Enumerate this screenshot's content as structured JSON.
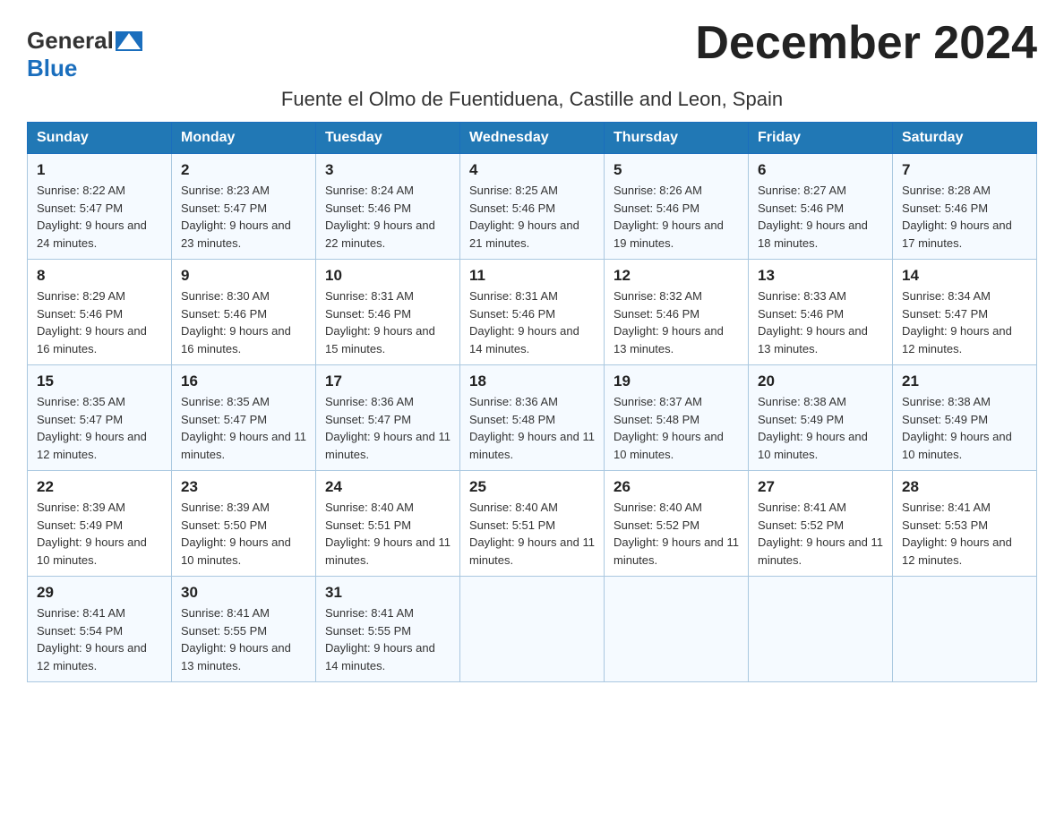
{
  "header": {
    "logo_general": "General",
    "logo_blue": "Blue",
    "month_title": "December 2024",
    "location": "Fuente el Olmo de Fuentiduena, Castille and Leon, Spain"
  },
  "days_of_week": [
    "Sunday",
    "Monday",
    "Tuesday",
    "Wednesday",
    "Thursday",
    "Friday",
    "Saturday"
  ],
  "weeks": [
    [
      {
        "day": "1",
        "sunrise": "8:22 AM",
        "sunset": "5:47 PM",
        "daylight": "9 hours and 24 minutes."
      },
      {
        "day": "2",
        "sunrise": "8:23 AM",
        "sunset": "5:47 PM",
        "daylight": "9 hours and 23 minutes."
      },
      {
        "day": "3",
        "sunrise": "8:24 AM",
        "sunset": "5:46 PM",
        "daylight": "9 hours and 22 minutes."
      },
      {
        "day": "4",
        "sunrise": "8:25 AM",
        "sunset": "5:46 PM",
        "daylight": "9 hours and 21 minutes."
      },
      {
        "day": "5",
        "sunrise": "8:26 AM",
        "sunset": "5:46 PM",
        "daylight": "9 hours and 19 minutes."
      },
      {
        "day": "6",
        "sunrise": "8:27 AM",
        "sunset": "5:46 PM",
        "daylight": "9 hours and 18 minutes."
      },
      {
        "day": "7",
        "sunrise": "8:28 AM",
        "sunset": "5:46 PM",
        "daylight": "9 hours and 17 minutes."
      }
    ],
    [
      {
        "day": "8",
        "sunrise": "8:29 AM",
        "sunset": "5:46 PM",
        "daylight": "9 hours and 16 minutes."
      },
      {
        "day": "9",
        "sunrise": "8:30 AM",
        "sunset": "5:46 PM",
        "daylight": "9 hours and 16 minutes."
      },
      {
        "day": "10",
        "sunrise": "8:31 AM",
        "sunset": "5:46 PM",
        "daylight": "9 hours and 15 minutes."
      },
      {
        "day": "11",
        "sunrise": "8:31 AM",
        "sunset": "5:46 PM",
        "daylight": "9 hours and 14 minutes."
      },
      {
        "day": "12",
        "sunrise": "8:32 AM",
        "sunset": "5:46 PM",
        "daylight": "9 hours and 13 minutes."
      },
      {
        "day": "13",
        "sunrise": "8:33 AM",
        "sunset": "5:46 PM",
        "daylight": "9 hours and 13 minutes."
      },
      {
        "day": "14",
        "sunrise": "8:34 AM",
        "sunset": "5:47 PM",
        "daylight": "9 hours and 12 minutes."
      }
    ],
    [
      {
        "day": "15",
        "sunrise": "8:35 AM",
        "sunset": "5:47 PM",
        "daylight": "9 hours and 12 minutes."
      },
      {
        "day": "16",
        "sunrise": "8:35 AM",
        "sunset": "5:47 PM",
        "daylight": "9 hours and 11 minutes."
      },
      {
        "day": "17",
        "sunrise": "8:36 AM",
        "sunset": "5:47 PM",
        "daylight": "9 hours and 11 minutes."
      },
      {
        "day": "18",
        "sunrise": "8:36 AM",
        "sunset": "5:48 PM",
        "daylight": "9 hours and 11 minutes."
      },
      {
        "day": "19",
        "sunrise": "8:37 AM",
        "sunset": "5:48 PM",
        "daylight": "9 hours and 10 minutes."
      },
      {
        "day": "20",
        "sunrise": "8:38 AM",
        "sunset": "5:49 PM",
        "daylight": "9 hours and 10 minutes."
      },
      {
        "day": "21",
        "sunrise": "8:38 AM",
        "sunset": "5:49 PM",
        "daylight": "9 hours and 10 minutes."
      }
    ],
    [
      {
        "day": "22",
        "sunrise": "8:39 AM",
        "sunset": "5:49 PM",
        "daylight": "9 hours and 10 minutes."
      },
      {
        "day": "23",
        "sunrise": "8:39 AM",
        "sunset": "5:50 PM",
        "daylight": "9 hours and 10 minutes."
      },
      {
        "day": "24",
        "sunrise": "8:40 AM",
        "sunset": "5:51 PM",
        "daylight": "9 hours and 11 minutes."
      },
      {
        "day": "25",
        "sunrise": "8:40 AM",
        "sunset": "5:51 PM",
        "daylight": "9 hours and 11 minutes."
      },
      {
        "day": "26",
        "sunrise": "8:40 AM",
        "sunset": "5:52 PM",
        "daylight": "9 hours and 11 minutes."
      },
      {
        "day": "27",
        "sunrise": "8:41 AM",
        "sunset": "5:52 PM",
        "daylight": "9 hours and 11 minutes."
      },
      {
        "day": "28",
        "sunrise": "8:41 AM",
        "sunset": "5:53 PM",
        "daylight": "9 hours and 12 minutes."
      }
    ],
    [
      {
        "day": "29",
        "sunrise": "8:41 AM",
        "sunset": "5:54 PM",
        "daylight": "9 hours and 12 minutes."
      },
      {
        "day": "30",
        "sunrise": "8:41 AM",
        "sunset": "5:55 PM",
        "daylight": "9 hours and 13 minutes."
      },
      {
        "day": "31",
        "sunrise": "8:41 AM",
        "sunset": "5:55 PM",
        "daylight": "9 hours and 14 minutes."
      },
      null,
      null,
      null,
      null
    ]
  ]
}
